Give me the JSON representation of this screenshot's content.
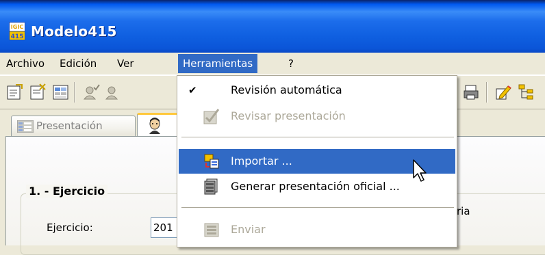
{
  "window": {
    "title": "Modelo415",
    "icon_text_top": "IGIC",
    "icon_text_bottom": "415"
  },
  "menubar": {
    "items": [
      {
        "label": "Archivo"
      },
      {
        "label": "Edición"
      },
      {
        "label": "Ver"
      },
      {
        "label": "Herramientas",
        "active": true
      },
      {
        "label": "?"
      }
    ]
  },
  "toolbar": {
    "buttons": [
      "new-document-icon",
      "new-document-2-icon",
      "form-grid-icon",
      "user-check-icon",
      "user-remove-icon",
      "printer-icon",
      "edit-pencil-icon",
      "tree-structure-icon"
    ]
  },
  "tabs": [
    {
      "label": "Presentación",
      "selected": false
    },
    {
      "label": "",
      "selected": true,
      "icon": "person-icon"
    }
  ],
  "panel": {
    "group_title": "1. - Ejercicio",
    "field_label": "Ejercicio:",
    "field_value": "201",
    "behind_text": "ria"
  },
  "dropdown": {
    "items": [
      {
        "label": "Revisión automática",
        "checked": true,
        "disabled": false,
        "icon": ""
      },
      {
        "label": "Revisar presentación",
        "checked": false,
        "disabled": true,
        "icon": "review-check-icon"
      },
      {
        "label": "Importar ...",
        "checked": false,
        "disabled": false,
        "highlighted": true,
        "icon": "import-icon"
      },
      {
        "label": "Generar presentación oficial ...",
        "checked": false,
        "disabled": false,
        "icon": "generate-document-icon"
      },
      {
        "label": "Enviar",
        "checked": false,
        "disabled": true,
        "icon": "send-icon"
      }
    ]
  },
  "colors": {
    "titlebar": "#0058EE",
    "menu_highlight": "#316AC5",
    "window_face": "#ECE9D8",
    "tab_accent": "#FFC83C",
    "disabled_text": "#ACA899"
  }
}
